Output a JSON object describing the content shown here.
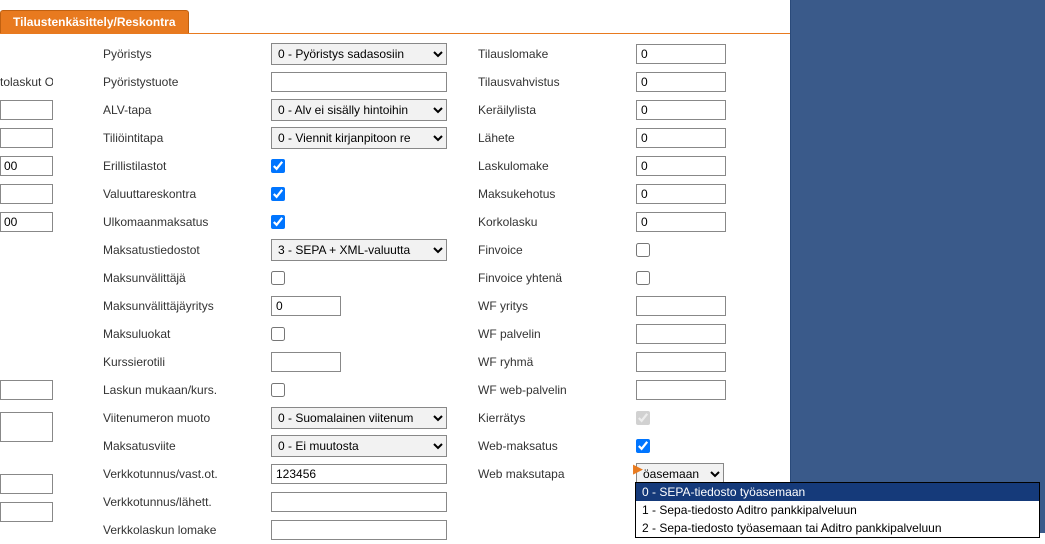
{
  "tab": {
    "label": "Tilaustenkäsittely/Reskontra"
  },
  "leftFrag": {
    "text1": "tolaskut Oy",
    "val1": "",
    "val2": "",
    "val3": "00",
    "val4": "",
    "val5": "00",
    "val6": "",
    "val7": "",
    "val8": "",
    "val9": ""
  },
  "col1": {
    "pyoristys": {
      "label": "Pyöristys",
      "value": "0 - Pyöristys sadasosiin"
    },
    "pyoristystuote": {
      "label": "Pyöristystuote",
      "value": ""
    },
    "alvtapa": {
      "label": "ALV-tapa",
      "value": "0 - Alv ei sisälly hintoihin"
    },
    "tiliointitapa": {
      "label": "Tiliöintitapa",
      "value": "0 - Viennit kirjanpitoon re"
    },
    "erillistilastot": {
      "label": "Erillistilastot",
      "checked": true
    },
    "valuuttareskontra": {
      "label": "Valuuttareskontra",
      "checked": true
    },
    "ulkomaanmaksatus": {
      "label": "Ulkomaanmaksatus",
      "checked": true
    },
    "maksatustiedostot": {
      "label": "Maksatustiedostot",
      "value": "3 - SEPA + XML-valuutta"
    },
    "maksunvalittaja": {
      "label": "Maksunvälittäjä",
      "checked": false
    },
    "maksunvalittajayritys": {
      "label": "Maksunvälittäjäyritys",
      "value": "0"
    },
    "maksuluokat": {
      "label": "Maksuluokat",
      "checked": false
    },
    "kurssierotili": {
      "label": "Kurssierotili",
      "value": ""
    },
    "laskunmukaan": {
      "label": "Laskun mukaan/kurs.",
      "checked": false
    },
    "viitenumeron": {
      "label": "Viitenumeron muoto",
      "value": "0 - Suomalainen viitenum"
    },
    "maksatusviite": {
      "label": "Maksatusviite",
      "value": "0 - Ei muutosta"
    },
    "verkkotunnusvast": {
      "label": "Verkkotunnus/vast.ot.",
      "value": "123456"
    },
    "verkkotunnuslahet": {
      "label": "Verkkotunnus/lähett.",
      "value": ""
    },
    "verkkolaskun": {
      "label": "Verkkolaskun lomake",
      "value": ""
    }
  },
  "col2": {
    "tilauslomake": {
      "label": "Tilauslomake",
      "value": "0"
    },
    "tilausvahvistus": {
      "label": "Tilausvahvistus",
      "value": "0"
    },
    "kerailylista": {
      "label": "Keräilylista",
      "value": "0"
    },
    "lahete": {
      "label": "Lähete",
      "value": "0"
    },
    "laskulomake": {
      "label": "Laskulomake",
      "value": "0"
    },
    "maksukehotus": {
      "label": "Maksukehotus",
      "value": "0"
    },
    "korkolasku": {
      "label": "Korkolasku",
      "value": "0"
    },
    "finvoice": {
      "label": "Finvoice",
      "checked": false
    },
    "finvoiceyhtena": {
      "label": "Finvoice yhtenä",
      "checked": false
    },
    "wfyritys": {
      "label": "WF yritys",
      "value": ""
    },
    "wfpalvelin": {
      "label": "WF palvelin",
      "value": ""
    },
    "wfryhma": {
      "label": "WF ryhmä",
      "value": ""
    },
    "wfwebpalvelin": {
      "label": "WF web-palvelin",
      "value": ""
    },
    "kierratys": {
      "label": "Kierrätys",
      "checked": true,
      "disabled": true
    },
    "webmaksatus": {
      "label": "Web-maksatus",
      "checked": true
    },
    "webmaksutapa": {
      "label": "Web maksutapa",
      "value": "öasemaan"
    }
  },
  "dropdown": {
    "options": [
      "0 - SEPA-tiedosto työasemaan",
      "1 - Sepa-tiedosto Aditro pankkipalveluun",
      "2 - Sepa-tiedosto työasemaan tai Aditro pankkipalveluun"
    ],
    "selectedIndex": 0
  }
}
